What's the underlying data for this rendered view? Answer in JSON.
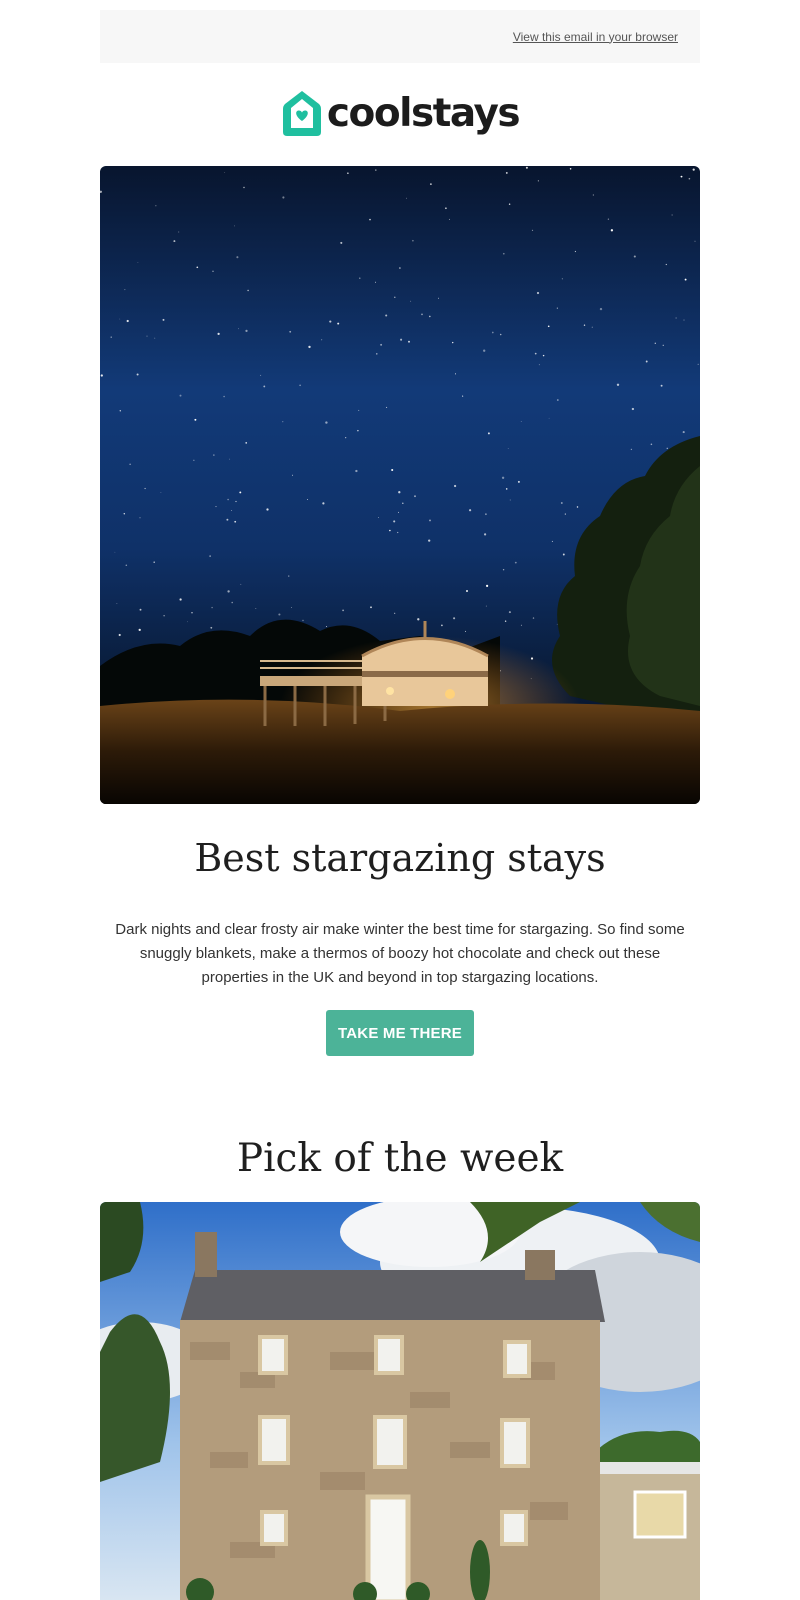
{
  "preheader": {
    "view_in_browser": "View this email in your browser"
  },
  "brand": {
    "name": "coolstays",
    "accent": "#1fbf9f",
    "icon": "house-heart-icon"
  },
  "hero": {
    "image": "yurt under starry night sky"
  },
  "main": {
    "headline": "Best stargazing stays",
    "intro": "Dark nights and clear frosty air make winter the best time for stargazing. So find some snuggly blankets, make a thermos of boozy hot chocolate and check out these properties in the UK and beyond in top stargazing locations.",
    "cta_label": "TAKE ME THERE",
    "cta_color": "#4cb398"
  },
  "pick": {
    "title": "Pick of the week",
    "image": "stone country house under cloudy sky"
  }
}
